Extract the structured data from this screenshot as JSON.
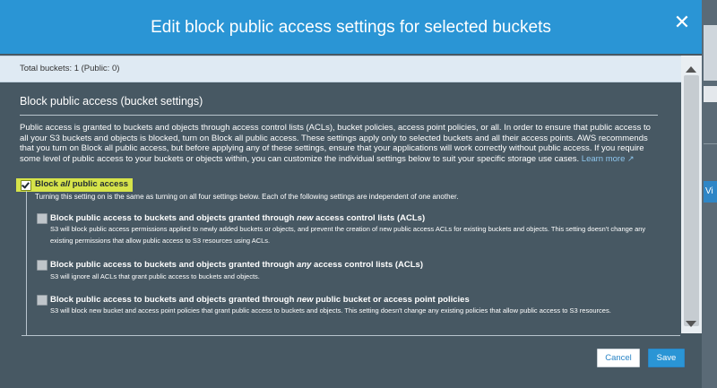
{
  "background": {
    "side_button_label": "Vi"
  },
  "dialog": {
    "title": "Edit block public access settings for selected buckets",
    "close_glyph": "✕",
    "summary": "Total buckets: 1 (Public: 0)",
    "section_title": "Block public access (bucket settings)",
    "description": "Public access is granted to buckets and objects through access control lists (ACLs), bucket policies, access point policies, or all. In order to ensure that public access to all your S3 buckets and objects is blocked, turn on Block all public access. These settings apply only to selected buckets and all their access points. AWS recommends that you turn on Block all public access, but before applying any of these settings, ensure that your applications will work correctly without public access. If you require some level of public access to your buckets or objects within, you can customize the individual settings below to suit your specific storage use cases.",
    "learn_more": "Learn more",
    "block_all": {
      "label_pre": "Block ",
      "label_em": "all",
      "label_post": " public access",
      "description": "Turning this setting on is the same as turning on all four settings below. Each of the following settings are independent of one another.",
      "checked": true
    },
    "options": [
      {
        "label_pre": "Block public access to buckets and objects granted through ",
        "label_em": "new",
        "label_post": " access control lists (ACLs)",
        "description": "S3 will block public access permissions applied to newly added buckets or objects, and prevent the creation of new public access ACLs for existing buckets and objects. This setting doesn't change any existing permissions that allow public access to S3 resources using ACLs.",
        "checked": false
      },
      {
        "label_pre": "Block public access to buckets and objects granted through ",
        "label_em": "any",
        "label_post": " access control lists (ACLs)",
        "description": "S3 will ignore all ACLs that grant public access to buckets and objects.",
        "checked": false
      },
      {
        "label_pre": "Block public access to buckets and objects granted through ",
        "label_em": "new",
        "label_post": " public bucket or access point policies",
        "description": "S3 will block new bucket and access point policies that grant public access to buckets and objects. This setting doesn't change any existing policies that allow public access to S3 resources.",
        "checked": false
      }
    ],
    "cancel_label": "Cancel",
    "save_label": "Save"
  },
  "colors": {
    "header": "#2a95d5",
    "body": "#475863",
    "highlight": "#d6e34a",
    "link": "#8fc7ef"
  },
  "icons": {
    "close": "close-icon",
    "external_link": "external-link-icon",
    "scroll_up": "scroll-up-arrow-icon",
    "scroll_down": "scroll-down-arrow-icon"
  }
}
